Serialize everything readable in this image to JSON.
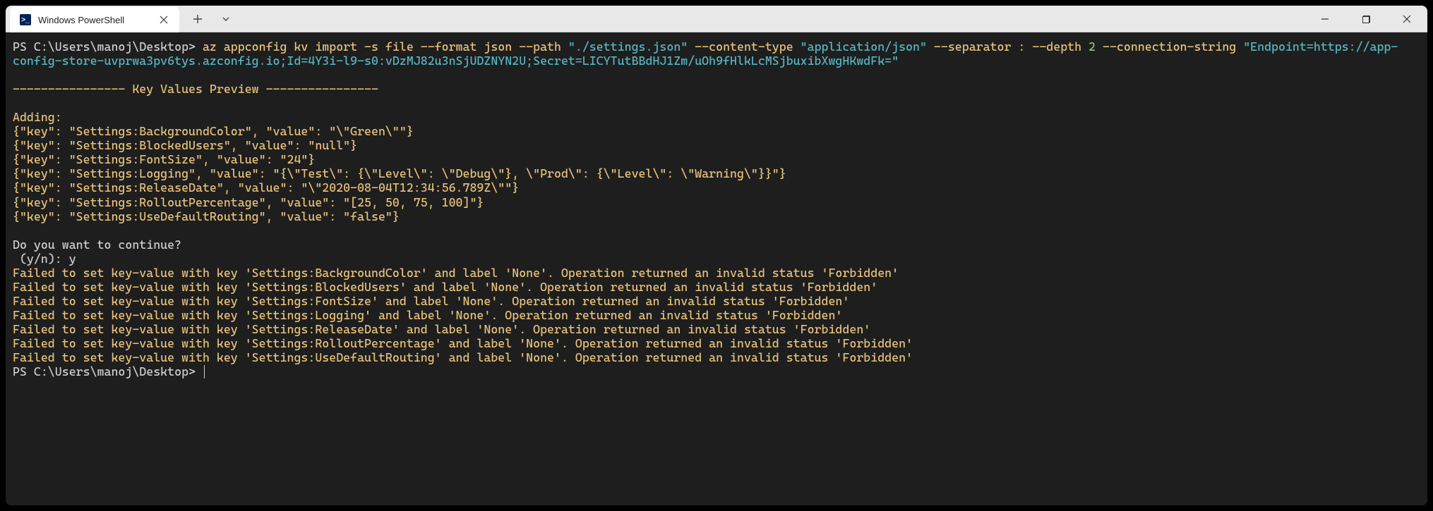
{
  "window": {
    "tab_title": "Windows PowerShell"
  },
  "terminal": {
    "prompt1": "PS C:\\Users\\manoj\\Desktop>",
    "cmd_part1": " az appconfig kv import -s file --format json --path ",
    "cmd_str1": "\"./settings.json\"",
    "cmd_part2": " --content-type ",
    "cmd_str2": "\"application/json\"",
    "cmd_part3": " --separator : --depth ",
    "cmd_num1": "2",
    "cmd_part4": " --connection-string ",
    "cmd_str3": "\"Endpoint=https://app-config-store-uvprwa3pv6tys.azconfig.io;Id=4Y3i-l9-s0:vDzMJ82u3nSjUDZNYN2U;Secret=LICYTutBBdHJ1Zm/uOh9fHlkLcMSjbuxibXwgHKwdFk=\"",
    "header": "---------------- Key Values Preview ----------------",
    "adding": "Adding:",
    "kv_lines": [
      "{\"key\": \"Settings:BackgroundColor\", \"value\": \"\\\"Green\\\"\"}",
      "{\"key\": \"Settings:BlockedUsers\", \"value\": \"null\"}",
      "{\"key\": \"Settings:FontSize\", \"value\": \"24\"}",
      "{\"key\": \"Settings:Logging\", \"value\": \"{\\\"Test\\\": {\\\"Level\\\": \\\"Debug\\\"}, \\\"Prod\\\": {\\\"Level\\\": \\\"Warning\\\"}}\"}",
      "{\"key\": \"Settings:ReleaseDate\", \"value\": \"\\\"2020-08-04T12:34:56.789Z\\\"\"}",
      "{\"key\": \"Settings:RolloutPercentage\", \"value\": \"[25, 50, 75, 100]\"}",
      "{\"key\": \"Settings:UseDefaultRouting\", \"value\": \"false\"}"
    ],
    "continue_q": "Do you want to continue?",
    "continue_prompt": " (y/n): y",
    "err_lines": [
      "Failed to set key-value with key 'Settings:BackgroundColor' and label 'None'. Operation returned an invalid status 'Forbidden'",
      "Failed to set key-value with key 'Settings:BlockedUsers' and label 'None'. Operation returned an invalid status 'Forbidden'",
      "Failed to set key-value with key 'Settings:FontSize' and label 'None'. Operation returned an invalid status 'Forbidden'",
      "Failed to set key-value with key 'Settings:Logging' and label 'None'. Operation returned an invalid status 'Forbidden'",
      "Failed to set key-value with key 'Settings:ReleaseDate' and label 'None'. Operation returned an invalid status 'Forbidden'",
      "Failed to set key-value with key 'Settings:RolloutPercentage' and label 'None'. Operation returned an invalid status 'Forbidden'",
      "Failed to set key-value with key 'Settings:UseDefaultRouting' and label 'None'. Operation returned an invalid status 'Forbidden'"
    ],
    "prompt2": "PS C:\\Users\\manoj\\Desktop>"
  }
}
